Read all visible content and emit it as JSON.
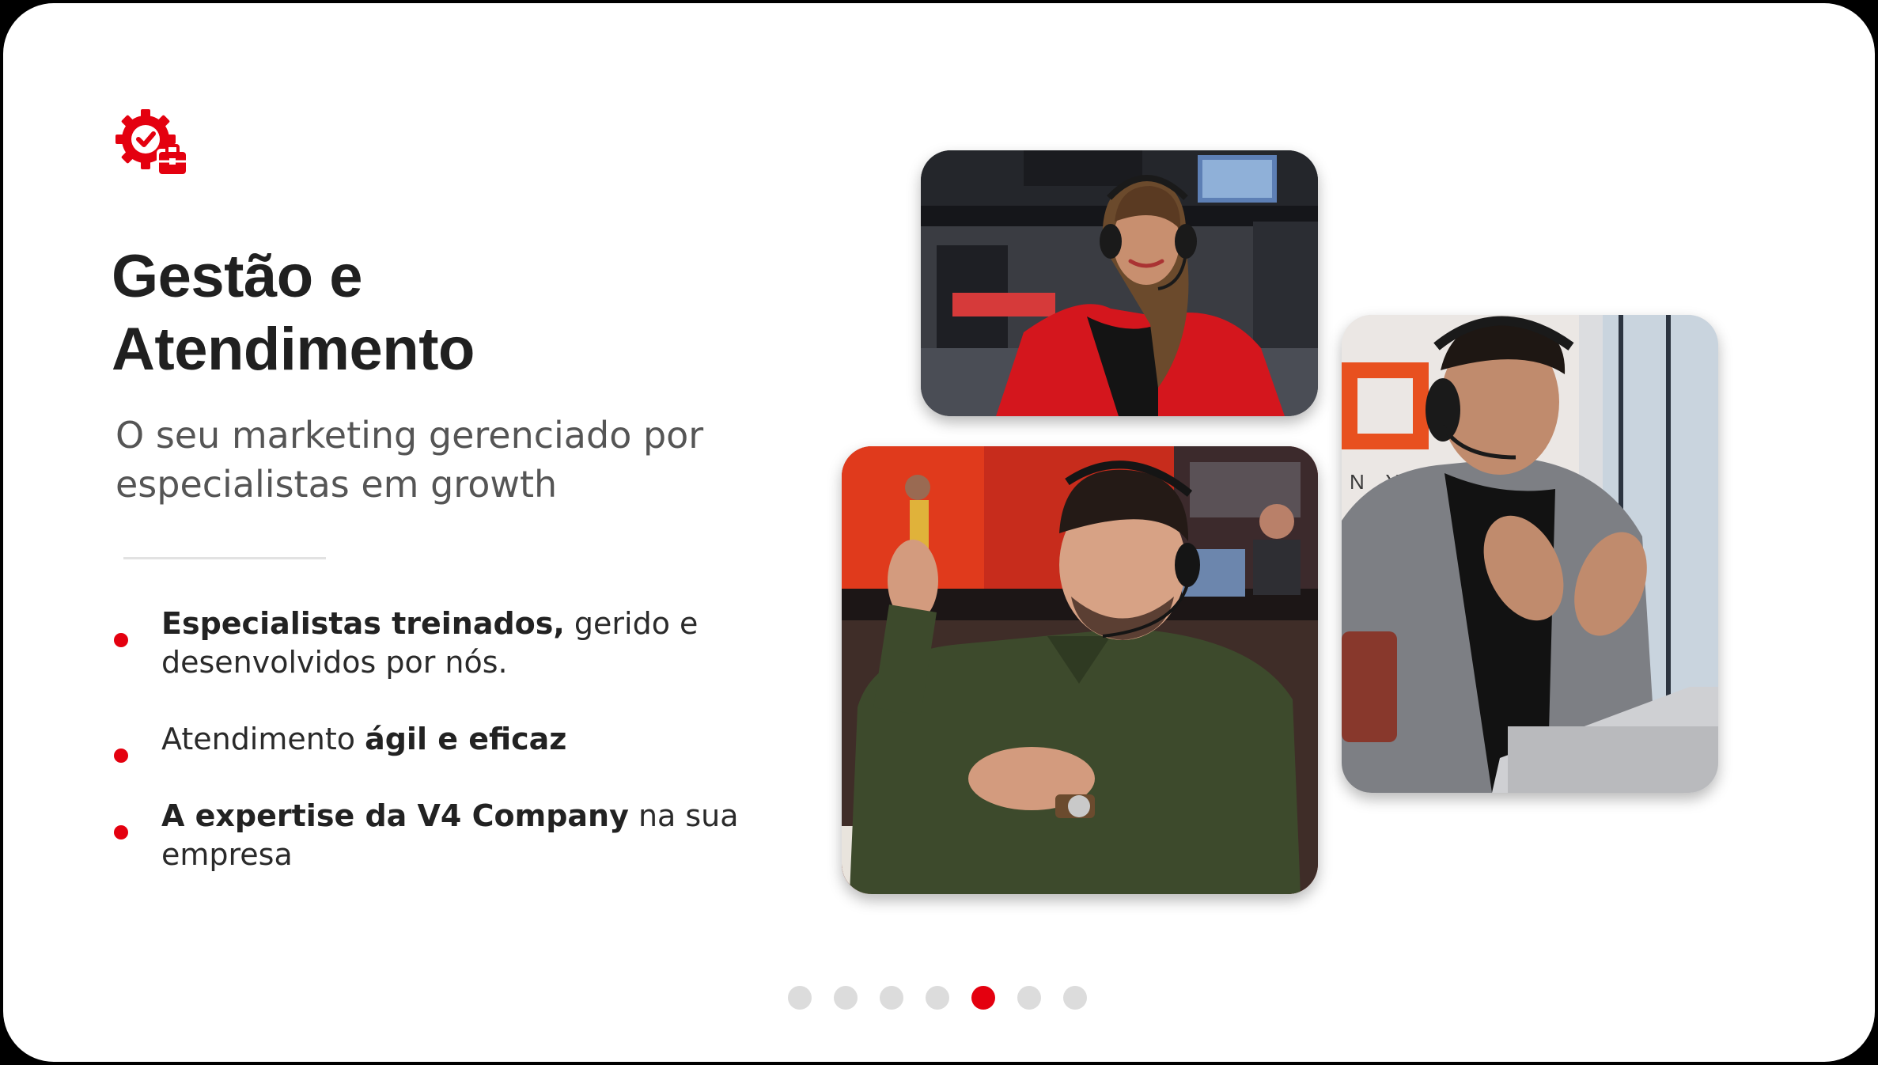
{
  "slide": {
    "icon": "gear-briefcase-icon",
    "accent_color": "#e4000f",
    "title_line1": "Gestão e",
    "title_line2": "Atendimento",
    "subtitle_line1": "O seu marketing gerenciado por",
    "subtitle_line2": "especialistas em growth",
    "bullets": [
      {
        "bold": "Especialistas treinados,",
        "text_line1": " gerido e",
        "text_line2": "desenvolvidos por nós."
      },
      {
        "text": "Atendimento ",
        "bold": "ágil e eficaz"
      },
      {
        "bold": "A expertise da V4 Company",
        "text_line1": " na sua",
        "text_line2": "empresa"
      }
    ],
    "photos": [
      {
        "alt": "woman-with-headset-photo"
      },
      {
        "alt": "man-with-headset-gesturing-photo"
      },
      {
        "alt": "man-in-gray-blazer-with-headset-photo"
      }
    ]
  },
  "pager": {
    "total": 7,
    "active_index": 4
  }
}
